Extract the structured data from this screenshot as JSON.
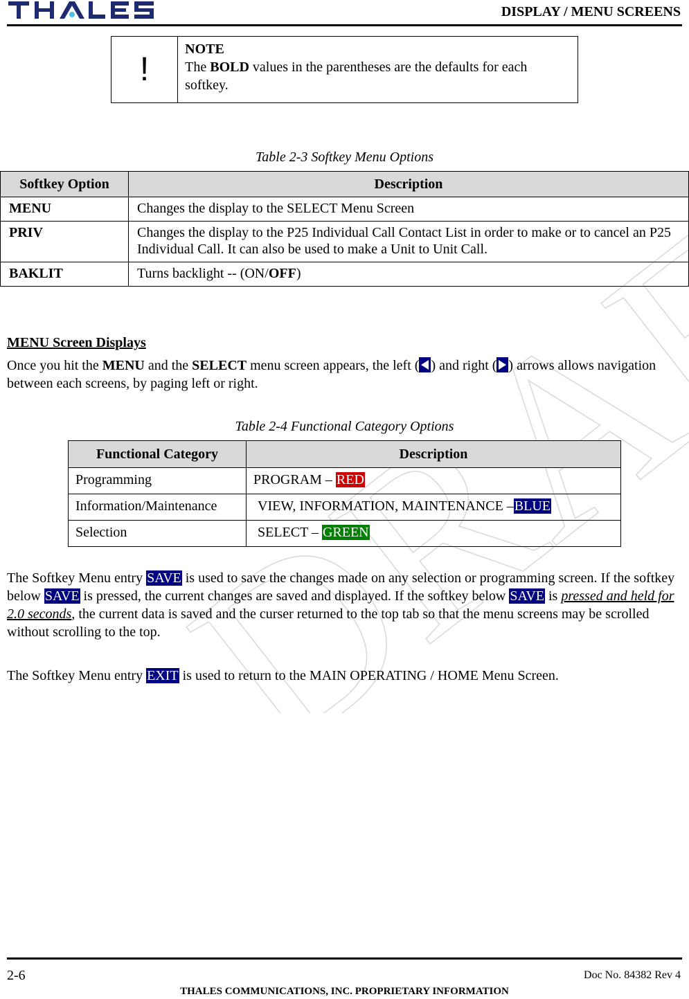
{
  "header": {
    "logo_text": "THALES",
    "section_title": "DISPLAY / MENU SCREENS",
    "brand_color": "#1d2a6e",
    "logo_accent_color": "#4cc3d9"
  },
  "note": {
    "icon": "exclamation-icon",
    "icon_glyph": "!",
    "title": "NOTE",
    "text_before": "The ",
    "text_bold": "BOLD",
    "text_after": " values in the parentheses are the defaults for each softkey."
  },
  "table_2_3": {
    "caption": "Table 2-3 Softkey Menu Options",
    "headers": [
      "Softkey Option",
      "Description"
    ],
    "rows": [
      {
        "key": "MENU",
        "desc": "Changes the display to the SELECT Menu Screen"
      },
      {
        "key": "PRIV",
        "desc": "Changes the display to the P25 Individual Call Contact List in order to make or to cancel an P25 Individual Call. It can also be used to make a Unit to Unit Call."
      },
      {
        "key": "BAKLIT",
        "desc_prefix": "Turns backlight -- (ON/",
        "desc_bold": "OFF",
        "desc_suffix": ")"
      }
    ]
  },
  "menu_section": {
    "heading": "MENU Screen Displays",
    "p1_a": "Once you hit the ",
    "p1_menu": "MENU",
    "p1_b": " and the ",
    "p1_select": "SELECT",
    "p1_c": " menu screen appears, the left (",
    "p1_d": ") and right (",
    "p1_e": ") arrows allows navigation between each screens, by paging left or right.",
    "left_arrow_icon": "left-arrow-icon",
    "right_arrow_icon": "right-arrow-icon"
  },
  "table_2_4": {
    "caption": "Table 2-4 Functional Category Options",
    "headers": [
      "Functional Category",
      "Description"
    ],
    "rows": [
      {
        "category": "Programming",
        "desc": "PROGRAM – ",
        "color_label": "RED",
        "color": "#cc0000"
      },
      {
        "category": "Information/Maintenance",
        "desc": "VIEW, INFORMATION, MAINTENANCE –",
        "color_label": "BLUE",
        "color": "#000080"
      },
      {
        "category": "Selection",
        "desc": "SELECT – ",
        "color_label": "GREEN",
        "color": "#008000"
      }
    ]
  },
  "save_paragraph": {
    "a": "The Softkey Menu entry ",
    "save1": "SAVE",
    "b": " is used to save the changes made on any selection or programming screen.  If the softkey below ",
    "save2": "SAVE",
    "c": " is pressed, the current changes are saved and displayed.  If the softkey below ",
    "save3": "SAVE",
    "d": " is ",
    "emphasis": "pressed and held for 2.0 seconds",
    "e": ", the current data is saved and the curser returned to the top tab so that the menu screens may be scrolled without scrolling to the top."
  },
  "exit_paragraph": {
    "a": "The Softkey Menu entry ",
    "exit": "EXIT",
    "b": " is used to return to the MAIN OPERATING / HOME Menu Screen."
  },
  "watermark": {
    "text": "DRAFT"
  },
  "footer": {
    "page_number": "2-6",
    "doc_number": "Doc No. 84382 Rev 4",
    "proprietary": "THALES COMMUNICATIONS, INC. PROPRIETARY INFORMATION"
  }
}
